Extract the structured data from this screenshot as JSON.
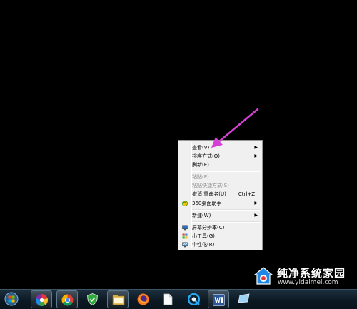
{
  "context_menu": {
    "items": [
      {
        "label": "查看(V)",
        "submenu": true,
        "disabled": false
      },
      {
        "label": "排序方式(O)",
        "submenu": true,
        "disabled": false
      },
      {
        "label": "刷新(E)",
        "submenu": false,
        "disabled": false
      },
      {
        "label": "粘贴(P)",
        "submenu": false,
        "disabled": true
      },
      {
        "label": "粘贴快捷方式(S)",
        "submenu": false,
        "disabled": true
      },
      {
        "label": "撤消 重命名(U)",
        "shortcut": "Ctrl+Z",
        "submenu": false,
        "disabled": false
      },
      {
        "label": "360桌面助手",
        "submenu": true,
        "disabled": false,
        "icon": "360-icon"
      },
      {
        "label": "新建(W)",
        "submenu": true,
        "disabled": false
      },
      {
        "label": "屏幕分辨率(C)",
        "submenu": false,
        "disabled": false,
        "icon": "monitor-icon"
      },
      {
        "label": "小工具(G)",
        "submenu": false,
        "disabled": false,
        "icon": "gadgets-icon"
      },
      {
        "label": "个性化(R)",
        "submenu": false,
        "disabled": false,
        "icon": "personalize-icon"
      }
    ],
    "submenu_arrow": "▶"
  },
  "watermark": {
    "title": "纯净系统家园",
    "url": "www.yidaimei.com"
  },
  "taskbar": {
    "items": [
      "start-orb-icon",
      "color-app-icon",
      "chrome-icon",
      "security-shield-icon",
      "file-explorer-icon",
      "firefox-icon",
      "document-icon",
      "qq-browser-icon",
      "word-icon",
      "window-icon"
    ]
  },
  "colors": {
    "desktop": "#000000",
    "menu_bg": "#f0f0f0",
    "arrow": "#d63fd6"
  }
}
